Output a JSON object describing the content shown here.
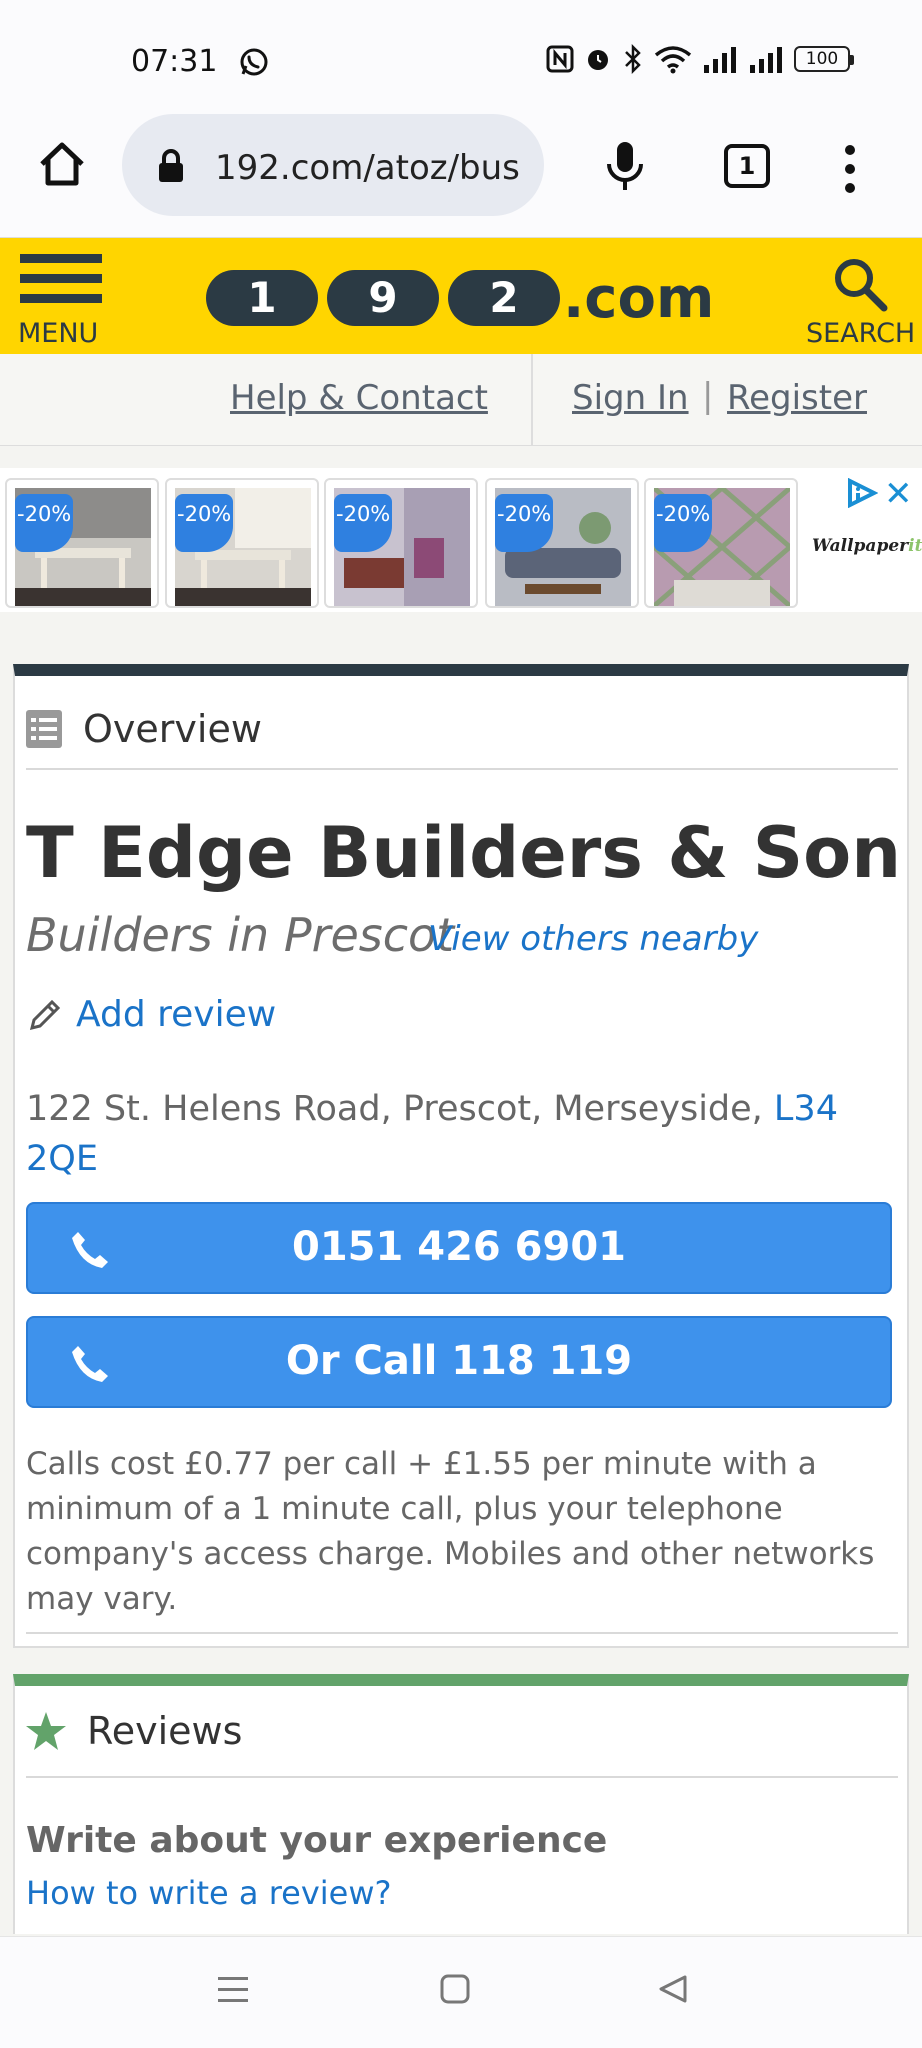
{
  "status_bar": {
    "time": "07:31",
    "battery": "100",
    "icons": [
      "whatsapp-icon",
      "nfc-icon",
      "alarm-icon",
      "bluetooth-icon",
      "wifi-icon",
      "signal-icon",
      "signal-icon"
    ]
  },
  "browser": {
    "url": "192.com/atoz/bus",
    "tab_count": "1"
  },
  "site_header": {
    "menu_label": "MENU",
    "logo_digits": [
      "1",
      "9",
      "2"
    ],
    "logo_suffix": ".com",
    "search_label": "SEARCH"
  },
  "subnav": {
    "help": "Help & Contact",
    "sign_in": "Sign In",
    "separator": "|",
    "register": "Register"
  },
  "ad": {
    "badges": [
      "-20%",
      "-20%",
      "-20%",
      "-20%",
      "-20%"
    ],
    "brand": "Wallpaper",
    "brand_suffix": "it"
  },
  "overview": {
    "heading": "Overview",
    "business_name": "T Edge Builders & Son",
    "category": "Builders in Prescot",
    "nearby_link": "View others nearby",
    "add_review": "Add review",
    "address": "122  St. Helens Road,  Prescot,  Merseyside,  ",
    "postcode": "L34 2QE",
    "phone_button": "0151 426 6901",
    "alt_call_button": "Or Call 118 119",
    "call_note": "Calls cost £0.77 per call + £1.55 per minute with a minimum of a 1 minute call, plus your telephone company's access charge. Mobiles and other networks may vary."
  },
  "reviews": {
    "heading": "Reviews",
    "write_prompt": "Write about your experience",
    "how_to_link": "How to write a review?"
  },
  "colors": {
    "brand_yellow": "#ffd500",
    "brand_dark": "#2b3a44",
    "link_blue": "#1a73c8",
    "button_blue": "#3e92ec",
    "reviews_green": "#62a36a"
  }
}
